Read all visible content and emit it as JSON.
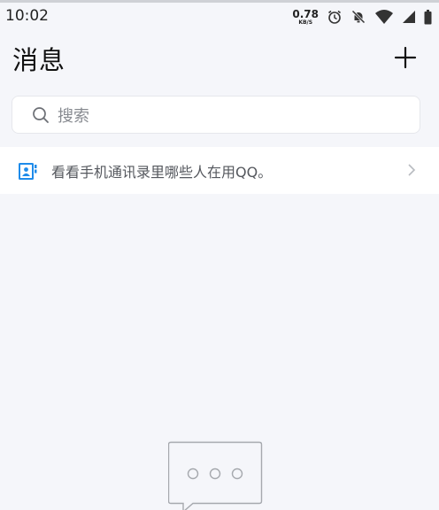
{
  "status_bar": {
    "time": "10:02",
    "net_speed_value": "0.78",
    "net_speed_unit": "KB/S",
    "icons": [
      "alarm-icon",
      "notifications-off-icon",
      "wifi-icon",
      "cell-signal-icon",
      "battery-icon"
    ]
  },
  "header": {
    "title": "消息",
    "action_icon": "plus-icon"
  },
  "search": {
    "placeholder": "搜索",
    "icon": "search-icon"
  },
  "contacts_banner": {
    "icon": "contact-book-icon",
    "text": "看看手机通讯录里哪些人在用QQ。",
    "accent_color": "#1e8bea"
  },
  "empty_state": {
    "icon": "chat-bubble-ellipsis-icon"
  }
}
